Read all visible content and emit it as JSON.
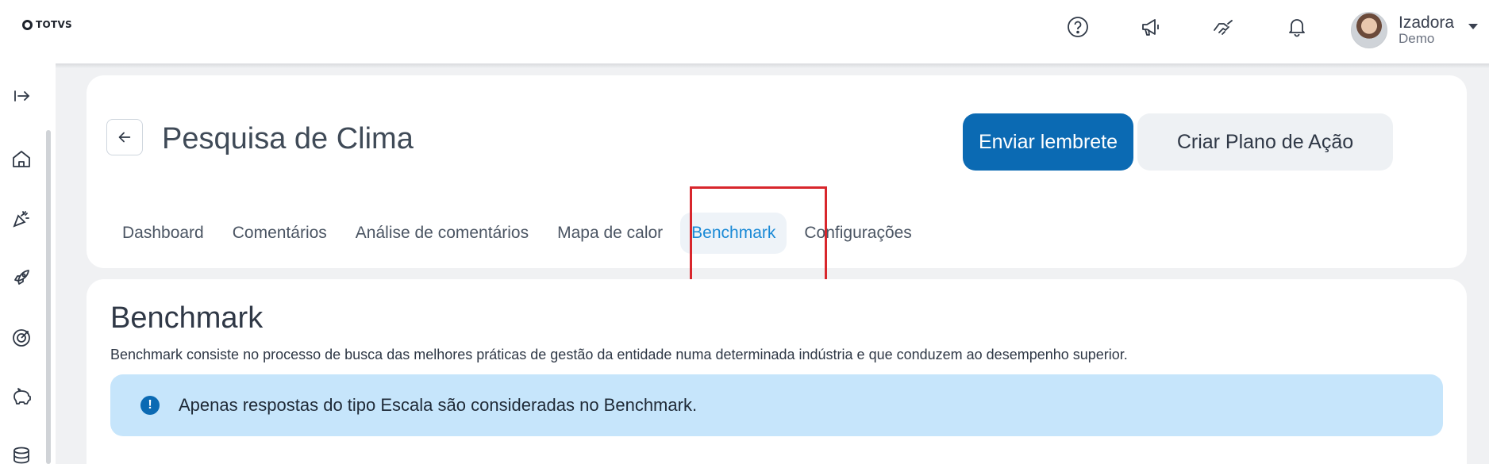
{
  "app": {
    "logo_text": "TOTVS"
  },
  "user": {
    "name": "Izadora",
    "subtitle": "Demo"
  },
  "top_icons": [
    "help-icon",
    "megaphone-icon",
    "handshake-icon",
    "bell-icon"
  ],
  "rail_icons": [
    "expand-sidebar-icon",
    "home-icon",
    "celebration-icon",
    "rocket-icon",
    "target-icon",
    "piggy-bank-icon",
    "coins-icon"
  ],
  "header": {
    "title": "Pesquisa de Clima",
    "primary_button": "Enviar lembrete",
    "secondary_button": "Criar Plano de Ação"
  },
  "tabs": [
    {
      "label": "Dashboard"
    },
    {
      "label": "Comentários"
    },
    {
      "label": "Análise de comentários"
    },
    {
      "label": "Mapa de calor"
    },
    {
      "label": "Benchmark"
    },
    {
      "label": "Configurações"
    }
  ],
  "active_tab": "Benchmark",
  "content": {
    "title": "Benchmark",
    "description": "Benchmark consiste no processo de busca das melhores práticas de gestão da entidade numa determinada indústria e que conduzem ao desempenho superior.",
    "info_banner": "Apenas respostas do tipo Escala são consideradas no Benchmark."
  },
  "colors": {
    "primary": "#0b6ab3",
    "active_tab_text": "#1b8ad6",
    "info_banner_bg": "#c6e5fb",
    "highlight": "#d8262c"
  }
}
